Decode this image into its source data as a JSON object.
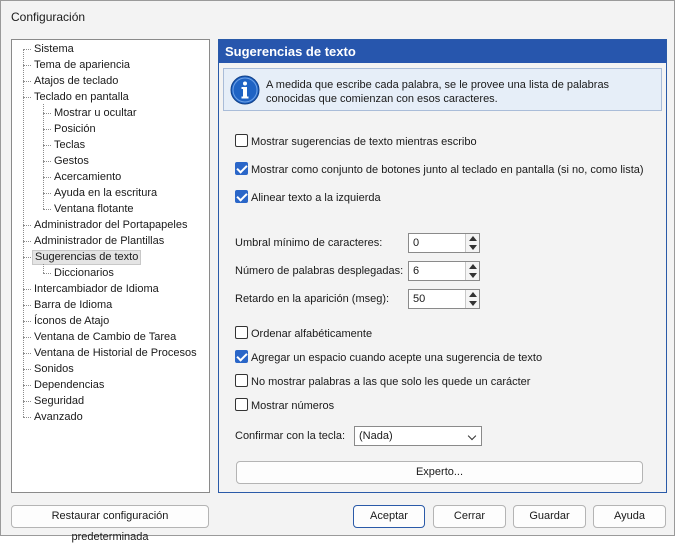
{
  "window": {
    "title": "Configuración"
  },
  "tree": {
    "items": [
      {
        "label": "Sistema",
        "level": 0
      },
      {
        "label": "Tema de apariencia",
        "level": 0
      },
      {
        "label": "Atajos de teclado",
        "level": 0
      },
      {
        "label": "Teclado en pantalla",
        "level": 0
      },
      {
        "label": "Mostrar u ocultar",
        "level": 1
      },
      {
        "label": "Posición",
        "level": 1
      },
      {
        "label": "Teclas",
        "level": 1
      },
      {
        "label": "Gestos",
        "level": 1
      },
      {
        "label": "Acercamiento",
        "level": 1
      },
      {
        "label": "Ayuda en la escritura",
        "level": 1
      },
      {
        "label": "Ventana flotante",
        "level": 1
      },
      {
        "label": "Administrador del Portapapeles",
        "level": 0
      },
      {
        "label": "Administrador de Plantillas",
        "level": 0
      },
      {
        "label": "Sugerencias de texto",
        "level": 0,
        "selected": true
      },
      {
        "label": "Diccionarios",
        "level": 1
      },
      {
        "label": "Intercambiador de Idioma",
        "level": 0
      },
      {
        "label": "Barra de Idioma",
        "level": 0
      },
      {
        "label": "Íconos de Atajo",
        "level": 0
      },
      {
        "label": "Ventana de Cambio de Tarea",
        "level": 0
      },
      {
        "label": "Ventana de Historial de Procesos",
        "level": 0
      },
      {
        "label": "Sonidos",
        "level": 0
      },
      {
        "label": "Dependencias",
        "level": 0
      },
      {
        "label": "Seguridad",
        "level": 0
      },
      {
        "label": "Avanzado",
        "level": 0
      }
    ]
  },
  "panel": {
    "title": "Sugerencias de texto",
    "info_icon": "info-icon",
    "info_text": "A medida que escribe cada palabra, se le provee una lista de palabras conocidas que comienzan con esos caracteres.",
    "options1": [
      {
        "label": "Mostrar sugerencias de texto mientras escribo",
        "checked": false
      },
      {
        "label": "Mostrar como conjunto de botones junto al teclado en pantalla (si no, como lista)",
        "checked": true
      },
      {
        "label": "Alinear texto a la izquierda",
        "checked": true
      }
    ],
    "fields": [
      {
        "label": "Umbral mínimo de caracteres:",
        "value": "0"
      },
      {
        "label": "Número de palabras desplegadas:",
        "value": "6"
      },
      {
        "label": "Retardo en la aparición (mseg):",
        "value": "50"
      }
    ],
    "options2": [
      {
        "label": "Ordenar alfabéticamente",
        "checked": false
      },
      {
        "label": "Agregar un espacio cuando acepte una sugerencia de texto",
        "checked": true
      },
      {
        "label": "No mostrar palabras a las que solo les quede un carácter",
        "checked": false
      },
      {
        "label": "Mostrar números",
        "checked": false
      }
    ],
    "confirm_label": "Confirmar con la tecla:",
    "confirm_value": "(Nada)",
    "expert_button": "Experto..."
  },
  "footer": {
    "restore": "Restaurar configuración predeterminada",
    "accept": "Aceptar",
    "cancel": "Cerrar",
    "save": "Guardar",
    "help": "Ayuda"
  },
  "colors": {
    "header_bg": "#2756ad",
    "accent": "#2a66c8",
    "info_bg": "#e6eef8"
  }
}
